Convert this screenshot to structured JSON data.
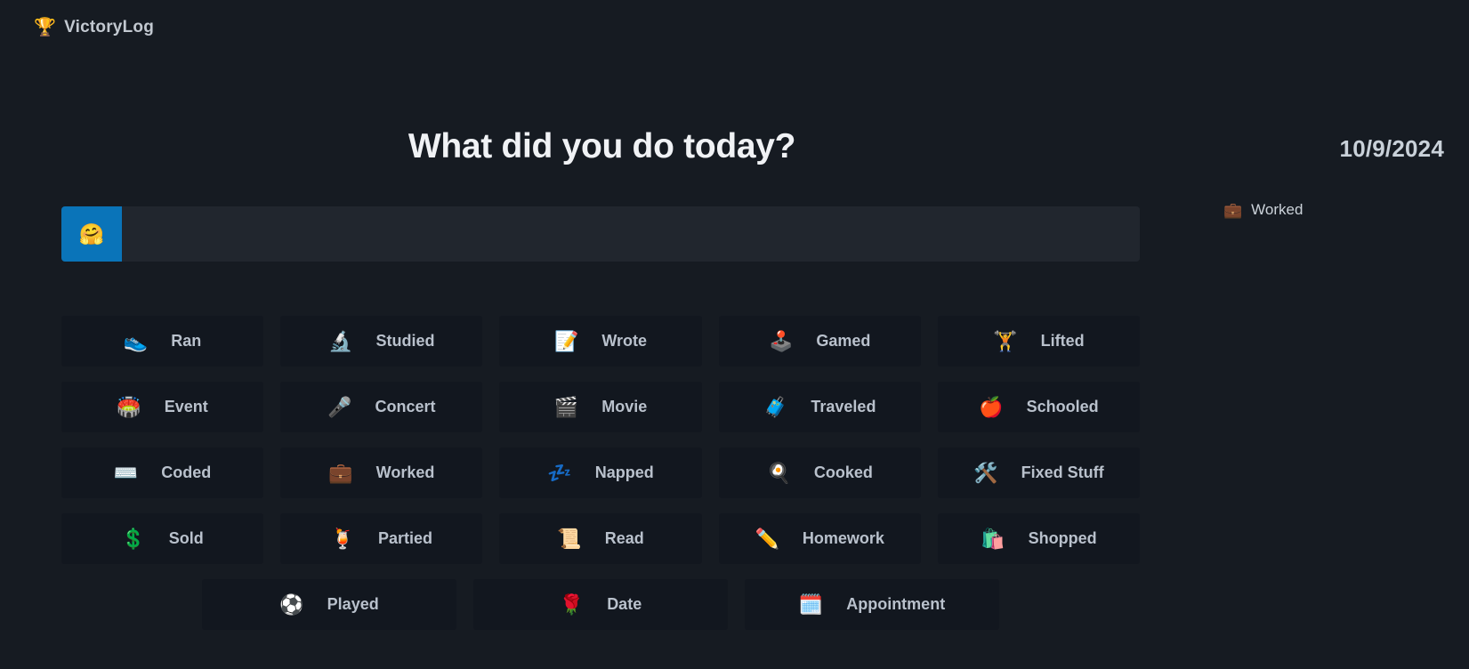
{
  "brand": {
    "icon": "trophy-icon",
    "glyph": "🏆",
    "name": "VictoryLog"
  },
  "header": {
    "title": "What did you do today?",
    "date": "10/9/2024"
  },
  "entry": {
    "emoji_button_glyph": "🤗",
    "emoji_button_name": "emoji-picker-button",
    "input_value": "",
    "input_placeholder": ""
  },
  "activities": {
    "rows": [
      [
        {
          "label": "Ran",
          "glyph": "👟",
          "icon": "running-shoe-icon"
        },
        {
          "label": "Studied",
          "glyph": "🔬",
          "icon": "microscope-icon"
        },
        {
          "label": "Wrote",
          "glyph": "📝",
          "icon": "memo-icon"
        },
        {
          "label": "Gamed",
          "glyph": "🕹️",
          "icon": "joystick-icon"
        },
        {
          "label": "Lifted",
          "glyph": "🏋️",
          "icon": "weightlifter-icon"
        }
      ],
      [
        {
          "label": "Event",
          "glyph": "🏟️",
          "icon": "stadium-icon"
        },
        {
          "label": "Concert",
          "glyph": "🎤",
          "icon": "microphone-icon"
        },
        {
          "label": "Movie",
          "glyph": "🎬",
          "icon": "clapper-board-icon"
        },
        {
          "label": "Traveled",
          "glyph": "🧳",
          "icon": "luggage-icon"
        },
        {
          "label": "Schooled",
          "glyph": "🍎",
          "icon": "apple-icon"
        }
      ],
      [
        {
          "label": "Coded",
          "glyph": "⌨️",
          "icon": "keyboard-icon"
        },
        {
          "label": "Worked",
          "glyph": "💼",
          "icon": "briefcase-icon"
        },
        {
          "label": "Napped",
          "glyph": "💤",
          "icon": "zzz-icon"
        },
        {
          "label": "Cooked",
          "glyph": "🍳",
          "icon": "cooking-icon"
        },
        {
          "label": "Fixed Stuff",
          "glyph": "🛠️",
          "icon": "hammer-and-wrench-icon"
        }
      ],
      [
        {
          "label": "Sold",
          "glyph": "💲",
          "icon": "dollar-sign-icon"
        },
        {
          "label": "Partied",
          "glyph": "🍹",
          "icon": "tropical-drink-icon"
        },
        {
          "label": "Read",
          "glyph": "📜",
          "icon": "scroll-icon"
        },
        {
          "label": "Homework",
          "glyph": "✏️",
          "icon": "pencil-icon"
        },
        {
          "label": "Shopped",
          "glyph": "🛍️",
          "icon": "shopping-bags-icon"
        }
      ],
      [
        {
          "label": "Played",
          "glyph": "⚽",
          "icon": "soccer-ball-icon"
        },
        {
          "label": "Date",
          "glyph": "🌹",
          "icon": "rose-icon"
        },
        {
          "label": "Appointment",
          "glyph": "🗓️",
          "icon": "spiral-calendar-icon"
        }
      ]
    ]
  },
  "log": {
    "entries": [
      {
        "label": "Worked",
        "glyph": "💼",
        "icon": "briefcase-icon"
      }
    ]
  },
  "colors": {
    "background": "#161b22",
    "panel": "#12171f",
    "input": "#21262e",
    "accent": "#0a74b9",
    "text": "#c9d1d9",
    "title": "#f0f2f5"
  }
}
